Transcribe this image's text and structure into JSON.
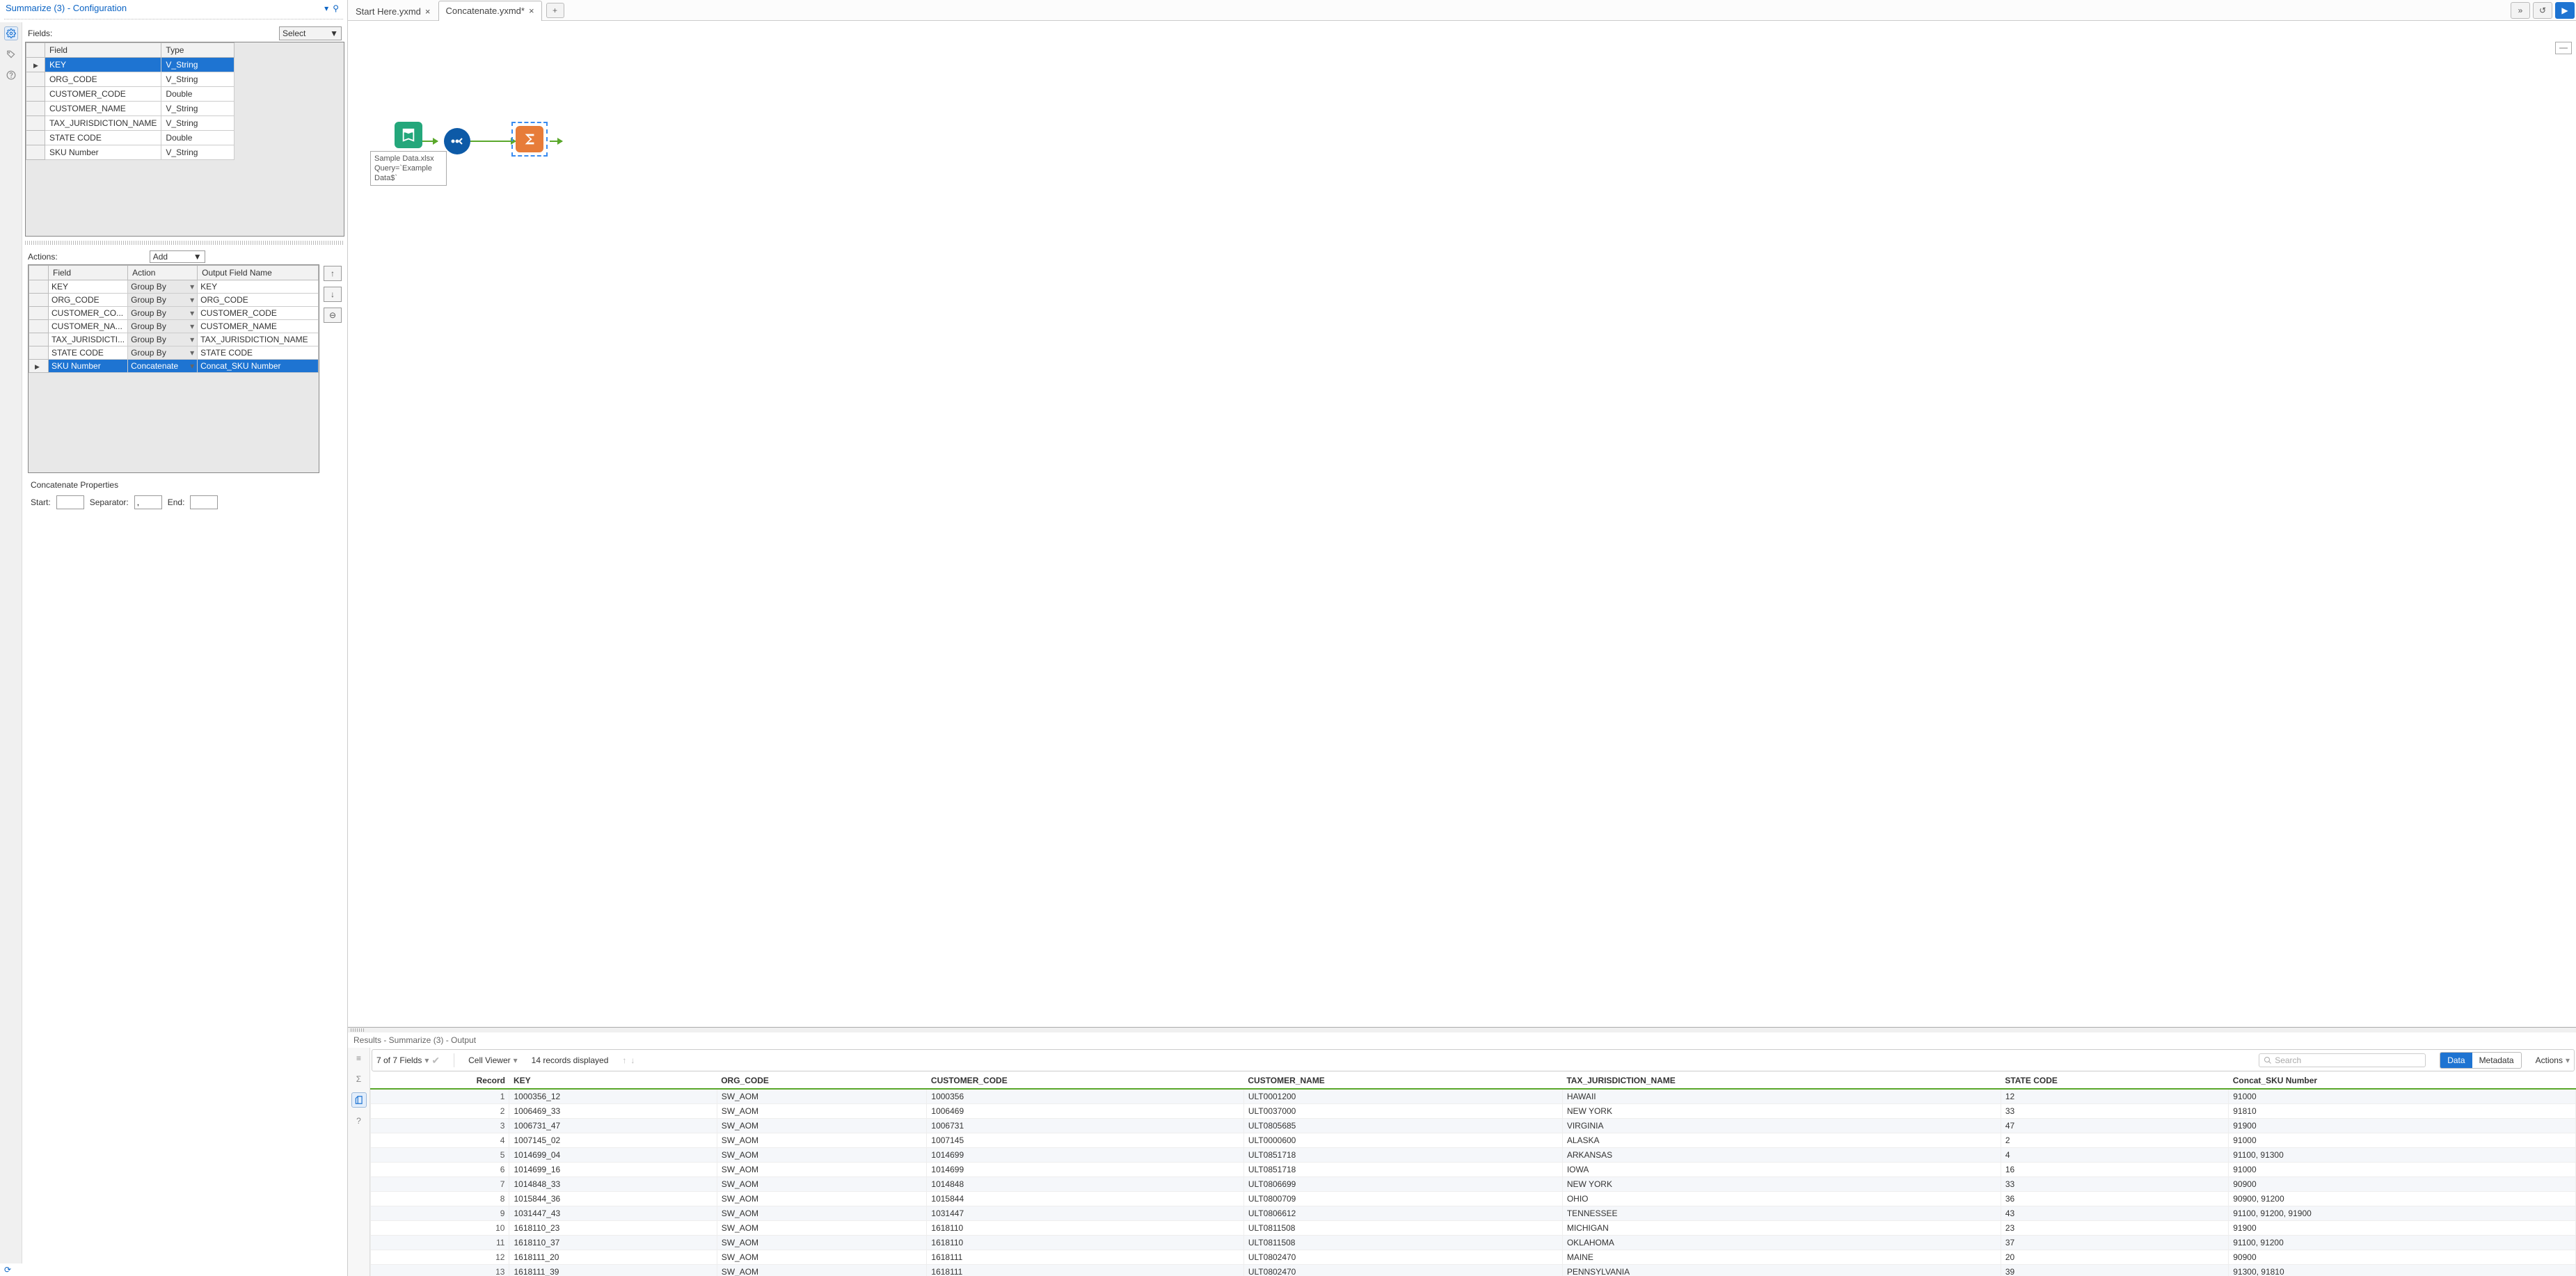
{
  "config": {
    "title": "Summarize (3) - Configuration",
    "fields_label": "Fields:",
    "select_button": "Select",
    "fields_columns": [
      "Field",
      "Type"
    ],
    "fields_rows": [
      {
        "field": "KEY",
        "type": "V_String",
        "selected": true
      },
      {
        "field": "ORG_CODE",
        "type": "V_String"
      },
      {
        "field": "CUSTOMER_CODE",
        "type": "Double"
      },
      {
        "field": "CUSTOMER_NAME",
        "type": "V_String"
      },
      {
        "field": "TAX_JURISDICTION_NAME",
        "type": "V_String"
      },
      {
        "field": "STATE CODE",
        "type": "Double"
      },
      {
        "field": "SKU Number",
        "type": "V_String"
      }
    ],
    "actions_label": "Actions:",
    "add_button": "Add",
    "actions_columns": [
      "Field",
      "Action",
      "Output Field Name"
    ],
    "actions_rows": [
      {
        "field": "KEY",
        "action": "Group By",
        "out": "KEY"
      },
      {
        "field": "ORG_CODE",
        "action": "Group By",
        "out": "ORG_CODE"
      },
      {
        "field": "CUSTOMER_CO...",
        "action": "Group By",
        "out": "CUSTOMER_CODE"
      },
      {
        "field": "CUSTOMER_NA...",
        "action": "Group By",
        "out": "CUSTOMER_NAME"
      },
      {
        "field": "TAX_JURISDICTI...",
        "action": "Group By",
        "out": "TAX_JURISDICTION_NAME"
      },
      {
        "field": "STATE CODE",
        "action": "Group By",
        "out": "STATE CODE"
      },
      {
        "field": "SKU Number",
        "action": "Concatenate",
        "out": "Concat_SKU Number",
        "selected": true
      }
    ],
    "concat_title": "Concatenate Properties",
    "start_label": "Start:",
    "sep_label": "Separator:",
    "sep_value": ",",
    "end_label": "End:"
  },
  "tabs": [
    {
      "label": "Start Here.yxmd",
      "active": false
    },
    {
      "label": "Concatenate.yxmd*",
      "active": true
    }
  ],
  "canvas": {
    "annotation": "Sample Data.xlsx\nQuery=`Example Data$`"
  },
  "results": {
    "title": "Results - Summarize (3) - Output",
    "field_count": "7 of 7 Fields",
    "cell_viewer": "Cell Viewer",
    "record_count": "14 records displayed",
    "search_placeholder": "Search",
    "toggle_data": "Data",
    "toggle_meta": "Metadata",
    "actions_btn": "Actions",
    "columns": [
      "Record",
      "KEY",
      "ORG_CODE",
      "CUSTOMER_CODE",
      "CUSTOMER_NAME",
      "TAX_JURISDICTION_NAME",
      "STATE CODE",
      "Concat_SKU Number"
    ],
    "rows": [
      [
        "1",
        "1000356_12",
        "SW_AOM",
        "1000356",
        "ULT0001200",
        "HAWAII",
        "12",
        "91000"
      ],
      [
        "2",
        "1006469_33",
        "SW_AOM",
        "1006469",
        "ULT0037000",
        "NEW YORK",
        "33",
        "91810"
      ],
      [
        "3",
        "1006731_47",
        "SW_AOM",
        "1006731",
        "ULT0805685",
        "VIRGINIA",
        "47",
        "91900"
      ],
      [
        "4",
        "1007145_02",
        "SW_AOM",
        "1007145",
        "ULT0000600",
        "ALASKA",
        "2",
        "91000"
      ],
      [
        "5",
        "1014699_04",
        "SW_AOM",
        "1014699",
        "ULT0851718",
        "ARKANSAS",
        "4",
        "91100, 91300"
      ],
      [
        "6",
        "1014699_16",
        "SW_AOM",
        "1014699",
        "ULT0851718",
        "IOWA",
        "16",
        "91000"
      ],
      [
        "7",
        "1014848_33",
        "SW_AOM",
        "1014848",
        "ULT0806699",
        "NEW YORK",
        "33",
        "90900"
      ],
      [
        "8",
        "1015844_36",
        "SW_AOM",
        "1015844",
        "ULT0800709",
        "OHIO",
        "36",
        "90900, 91200"
      ],
      [
        "9",
        "1031447_43",
        "SW_AOM",
        "1031447",
        "ULT0806612",
        "TENNESSEE",
        "43",
        "91100, 91200, 91900"
      ],
      [
        "10",
        "1618110_23",
        "SW_AOM",
        "1618110",
        "ULT0811508",
        "MICHIGAN",
        "23",
        "91900"
      ],
      [
        "11",
        "1618110_37",
        "SW_AOM",
        "1618110",
        "ULT0811508",
        "OKLAHOMA",
        "37",
        "91100, 91200"
      ],
      [
        "12",
        "1618111_20",
        "SW_AOM",
        "1618111",
        "ULT0802470",
        "MAINE",
        "20",
        "90900"
      ],
      [
        "13",
        "1618111_39",
        "SW_AOM",
        "1618111",
        "ULT0802470",
        "PENNSYLVANIA",
        "39",
        "91300, 91810"
      ]
    ]
  }
}
